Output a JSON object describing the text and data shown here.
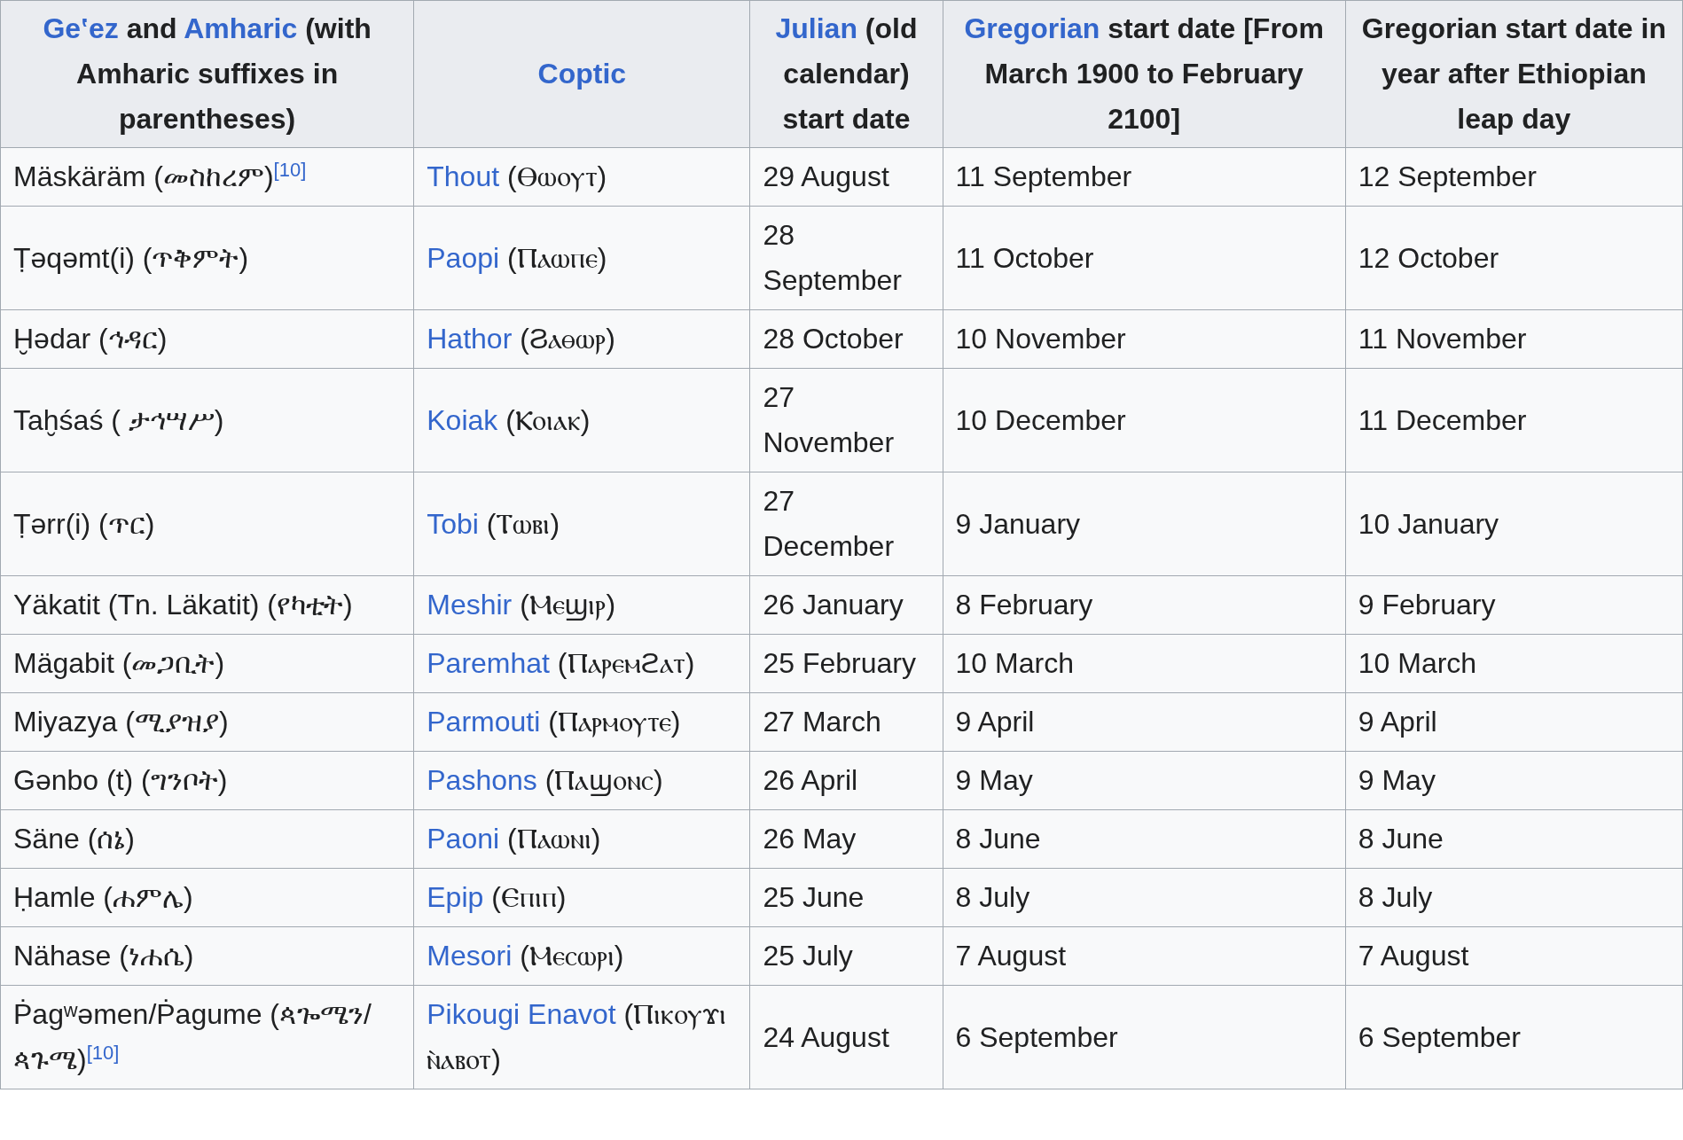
{
  "table": {
    "columns": [
      {
        "parts": [
          {
            "text": "Geʽez",
            "link": true
          },
          {
            "text": " and ",
            "link": false
          },
          {
            "text": "Amharic",
            "link": true
          },
          {
            "text": " (with Amharic suffixes in parentheses)",
            "link": false
          }
        ]
      },
      {
        "parts": [
          {
            "text": "Coptic",
            "link": true
          }
        ]
      },
      {
        "parts": [
          {
            "text": "Julian",
            "link": true
          },
          {
            "text": " (old calendar) start date",
            "link": false
          }
        ]
      },
      {
        "parts": [
          {
            "text": "Gregorian",
            "link": true
          },
          {
            "text": " start date [From March 1900 to February 2100]",
            "link": false
          }
        ]
      },
      {
        "parts": [
          {
            "text": "Gregorian start date in year after Ethiopian leap day",
            "link": false
          }
        ]
      }
    ],
    "rows": [
      {
        "name": "Mäskäräm (መስከረም)",
        "ref": "[10]",
        "coptic_link": "Thout",
        "coptic": "(Ⲑⲱⲟⲩⲧ)",
        "julian": "29 August",
        "gregorian": "11 September",
        "after_leap": "12 September"
      },
      {
        "name": "Ṭəqəmt(i) (ጥቅምት)",
        "coptic_link": "Paopi",
        "coptic": "(Ⲡⲁⲱⲡⲉ)",
        "julian": "28 September",
        "gregorian": "11 October",
        "after_leap": "12 October"
      },
      {
        "name": "Ḫədar (ኅዳር)",
        "coptic_link": "Hathor",
        "coptic": "(Ϩⲁⲑⲱⲣ)",
        "julian": "28 October",
        "gregorian": "10 November",
        "after_leap": "11 November"
      },
      {
        "name": "Taḫśaś ( ታኅሣሥ)",
        "coptic_link": "Koiak",
        "coptic": "(Ⲕⲟⲓⲁⲕ)",
        "julian": "27 November",
        "gregorian": "10 December",
        "after_leap": "11 December"
      },
      {
        "name": "Ṭərr(i) (ጥር)",
        "coptic_link": "Tobi",
        "coptic": "(Ⲧⲱⲃⲓ)",
        "julian": "27 December",
        "gregorian": "9 January",
        "after_leap": "10 January"
      },
      {
        "name": "Yäkatit (Tn. Läkatit) (የካቲት)",
        "coptic_link": "Meshir",
        "coptic": "(Ⲙⲉϣⲓⲣ)",
        "julian": "26 January",
        "gregorian": "8 February",
        "after_leap": "9 February"
      },
      {
        "name": "Mägabit (መጋቢት)",
        "coptic_link": "Paremhat",
        "coptic": "(Ⲡⲁⲣⲉⲙϩⲁⲧ)",
        "julian": "25 February",
        "gregorian": "10 March",
        "after_leap": "10 March"
      },
      {
        "name": "Miyazya (ሚያዝያ)",
        "coptic_link": "Parmouti",
        "coptic": "(Ⲡⲁⲣⲙⲟⲩⲧⲉ)",
        "julian": "27 March",
        "gregorian": "9 April",
        "after_leap": "9 April"
      },
      {
        "name": "Gənbo (t) (ግንቦት)",
        "coptic_link": "Pashons",
        "coptic": "(Ⲡⲁϣⲟⲛⲥ)",
        "julian": "26 April",
        "gregorian": "9 May",
        "after_leap": "9 May"
      },
      {
        "name": "Säne (ሰኔ)",
        "coptic_link": "Paoni",
        "coptic": "(Ⲡⲁⲱⲛⲓ)",
        "julian": "26 May",
        "gregorian": "8 June",
        "after_leap": "8 June"
      },
      {
        "name": "Ḥamle (ሐምሌ)",
        "coptic_link": "Epip",
        "coptic": "(Ⲉⲡⲓⲡ)",
        "julian": "25 June",
        "gregorian": "8 July",
        "after_leap": "8 July"
      },
      {
        "name": "Nähase (ነሐሴ)",
        "coptic_link": "Mesori",
        "coptic": "(Ⲙⲉⲥⲱⲣⲓ)",
        "julian": "25 July",
        "gregorian": "7 August",
        "after_leap": "7 August"
      },
      {
        "name": "Ṗagʷəmen/Ṗagume (ጳጐሜን/ጳጉሜ)",
        "ref": "[10]",
        "coptic_link": "Pikougi Enavot",
        "coptic": "(Ⲡⲓⲕⲟⲩϫⲓ ⲛ̀ⲁⲃⲟⲧ)",
        "julian": "24 August",
        "gregorian": "6 September",
        "after_leap": "6 September"
      }
    ]
  }
}
